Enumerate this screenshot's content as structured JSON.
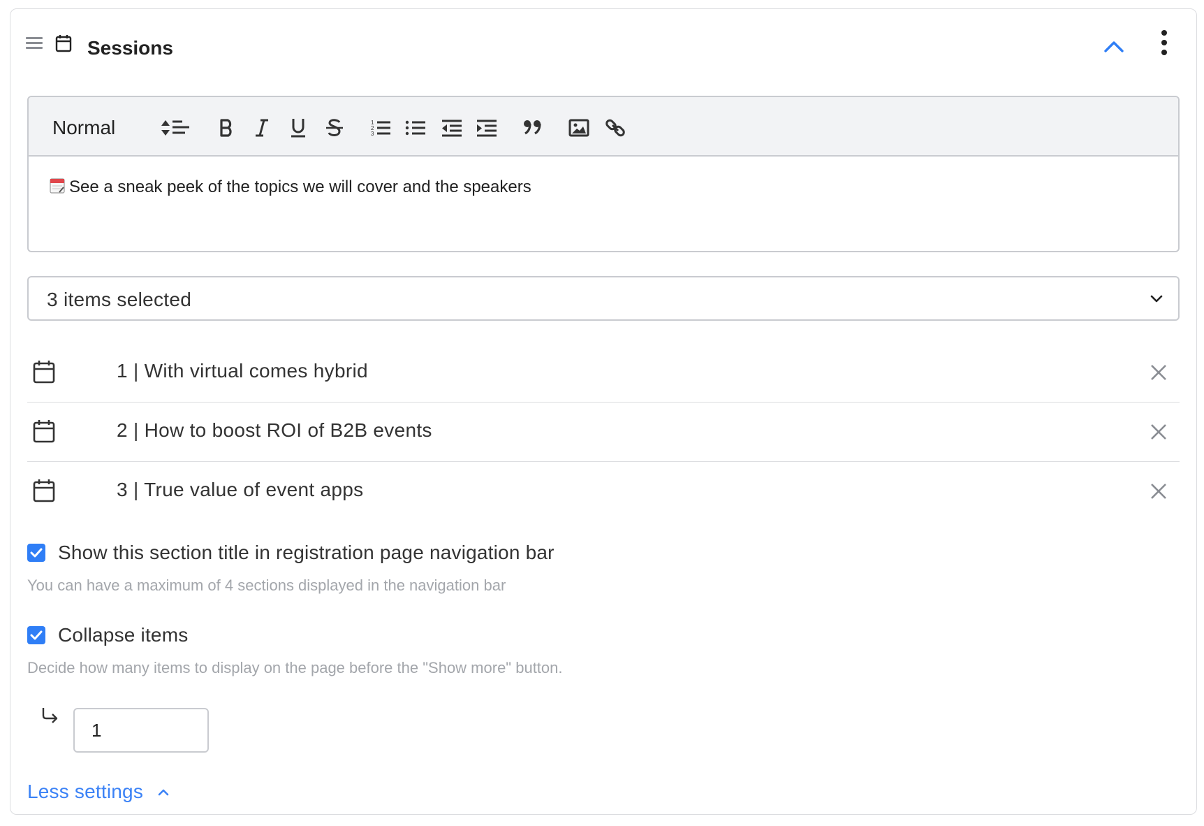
{
  "section": {
    "title": "Sessions"
  },
  "editor": {
    "format_label": "Normal",
    "content_emoji": "🗓️",
    "content_text": "See a sneak peek of the topics we will cover and the speakers",
    "toolbar": [
      "align-left-icon",
      "bold-icon",
      "italic-icon",
      "underline-icon",
      "strikethrough-icon",
      "ordered-list-icon",
      "bullet-list-icon",
      "outdent-icon",
      "indent-icon",
      "quote-icon",
      "image-icon",
      "link-icon"
    ]
  },
  "select": {
    "value": "3 items selected"
  },
  "items": [
    {
      "label": "1 | With virtual comes hybrid"
    },
    {
      "label": "2 | How to boost ROI of B2B events"
    },
    {
      "label": "3 | True value of event apps"
    }
  ],
  "options": {
    "show_in_nav": {
      "label": "Show this section title in registration page navigation bar",
      "hint": "You can have a maximum of 4 sections displayed in the navigation bar",
      "checked": true
    },
    "collapse_items": {
      "label": "Collapse items",
      "hint": "Decide how many items to display on the page before the \"Show more\" button.",
      "checked": true,
      "count": "1"
    }
  },
  "less_settings_label": "Less settings",
  "colors": {
    "accent": "#2f7ef6",
    "link": "#3b82f6",
    "muted": "#a3a6ab",
    "border": "#c9cbd0"
  }
}
